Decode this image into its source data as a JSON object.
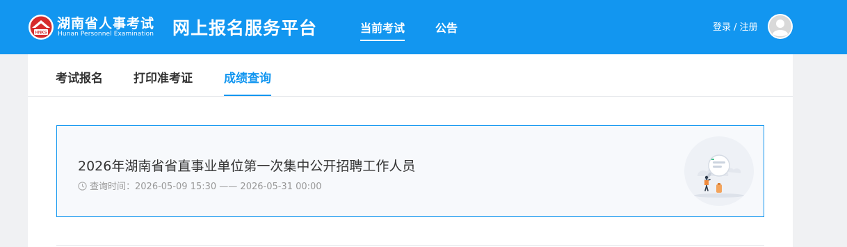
{
  "header": {
    "logo_badge": "HNKS",
    "logo_cn": "湖南省人事考试",
    "logo_en": "Hunan Personnel Examination",
    "platform_title": "网上报名服务平台",
    "nav": [
      {
        "label": "当前考试",
        "active": true
      },
      {
        "label": "公告",
        "active": false
      }
    ],
    "login_label": "登录 / 注册",
    "brand_color": "#1296f0"
  },
  "subtabs": [
    {
      "label": "考试报名",
      "active": false
    },
    {
      "label": "打印准考证",
      "active": false
    },
    {
      "label": "成绩查询",
      "active": true
    }
  ],
  "exams": [
    {
      "title": "2026年湖南省省直事业单位第一次集中公开招聘工作人员",
      "time_label": "查询时间：",
      "time_range": "2026-05-09 15:30 —— 2026-05-31 00:00",
      "icon": "clock-icon"
    }
  ]
}
